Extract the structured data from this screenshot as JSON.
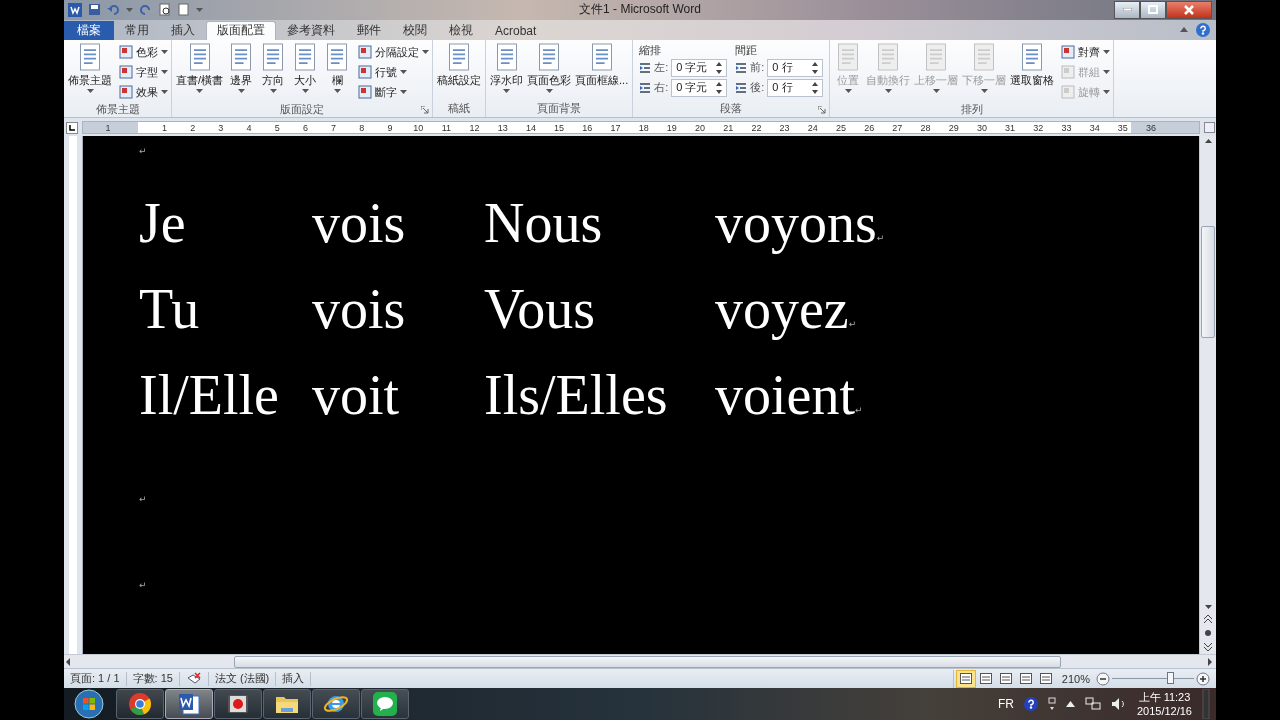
{
  "window": {
    "title": "文件1 - Microsoft Word"
  },
  "tabs": [
    {
      "label": "檔案",
      "kind": "file",
      "selected": false
    },
    {
      "label": "常用",
      "kind": "tab",
      "selected": false
    },
    {
      "label": "插入",
      "kind": "tab",
      "selected": false
    },
    {
      "label": "版面配置",
      "kind": "tab",
      "selected": true
    },
    {
      "label": "參考資料",
      "kind": "tab",
      "selected": false
    },
    {
      "label": "郵件",
      "kind": "tab",
      "selected": false
    },
    {
      "label": "校閱",
      "kind": "tab",
      "selected": false
    },
    {
      "label": "檢視",
      "kind": "tab",
      "selected": false
    },
    {
      "label": "Acrobat",
      "kind": "tab",
      "selected": false
    }
  ],
  "ribbon": {
    "groups": [
      {
        "label": "佈景主題",
        "launcher": false,
        "items": [
          {
            "kind": "large",
            "label": "佈景主題",
            "dropdown": true,
            "disabled": false
          },
          {
            "kind": "stack",
            "items": [
              {
                "label": "色彩",
                "dropdown": true,
                "disabled": false
              },
              {
                "label": "字型",
                "dropdown": true,
                "disabled": false
              },
              {
                "label": "效果",
                "dropdown": true,
                "disabled": false
              }
            ]
          }
        ]
      },
      {
        "label": "版面設定",
        "launcher": true,
        "items": [
          {
            "kind": "large",
            "label": "直書/橫書",
            "dropdown": true,
            "disabled": false
          },
          {
            "kind": "large",
            "label": "邊界",
            "dropdown": true,
            "disabled": false
          },
          {
            "kind": "large",
            "label": "方向",
            "dropdown": true,
            "disabled": false
          },
          {
            "kind": "large",
            "label": "大小",
            "dropdown": true,
            "disabled": false
          },
          {
            "kind": "large",
            "label": "欄",
            "dropdown": true,
            "disabled": false
          },
          {
            "kind": "stack",
            "items": [
              {
                "label": "分隔設定",
                "dropdown": true,
                "disabled": false
              },
              {
                "label": "行號",
                "dropdown": true,
                "disabled": false
              },
              {
                "label": "斷字",
                "dropdown": true,
                "disabled": false
              }
            ]
          }
        ]
      },
      {
        "label": "稿紙",
        "launcher": false,
        "items": [
          {
            "kind": "large",
            "label": "稿紙設定",
            "dropdown": false,
            "disabled": false
          }
        ]
      },
      {
        "label": "頁面背景",
        "launcher": false,
        "items": [
          {
            "kind": "large",
            "label": "浮水印",
            "dropdown": true,
            "disabled": false
          },
          {
            "kind": "large",
            "label": "頁面色彩",
            "dropdown": true,
            "disabled": false
          },
          {
            "kind": "large",
            "label": "頁面框線...",
            "dropdown": false,
            "disabled": false
          }
        ]
      },
      {
        "label": "段落",
        "launcher": true,
        "items": [
          {
            "kind": "spins",
            "heading": "縮排",
            "fields": [
              {
                "label": "左:",
                "value": "0 字元"
              },
              {
                "label": "右:",
                "value": "0 字元"
              }
            ]
          },
          {
            "kind": "spins",
            "heading": "間距",
            "fields": [
              {
                "label": "前:",
                "value": "0 行"
              },
              {
                "label": "後:",
                "value": "0 行"
              }
            ]
          }
        ]
      },
      {
        "label": "排列",
        "launcher": false,
        "items": [
          {
            "kind": "large",
            "label": "位置",
            "dropdown": true,
            "disabled": true
          },
          {
            "kind": "large",
            "label": "自動換行",
            "dropdown": true,
            "disabled": true
          },
          {
            "kind": "large",
            "label": "上移一層",
            "dropdown": true,
            "disabled": true
          },
          {
            "kind": "large",
            "label": "下移一層",
            "dropdown": true,
            "disabled": true
          },
          {
            "kind": "large",
            "label": "選取窗格",
            "dropdown": false,
            "disabled": false
          },
          {
            "kind": "stack",
            "items": [
              {
                "label": "對齊",
                "dropdown": true,
                "disabled": false
              },
              {
                "label": "群組",
                "dropdown": true,
                "disabled": true
              },
              {
                "label": "旋轉",
                "dropdown": true,
                "disabled": true
              }
            ]
          }
        ]
      }
    ]
  },
  "ruler": {
    "numbers": [
      "1",
      "1",
      "2",
      "3",
      "4",
      "5",
      "6",
      "7",
      "8",
      "9",
      "10",
      "11",
      "12",
      "13",
      "14",
      "15",
      "16",
      "17",
      "18",
      "19",
      "20",
      "21",
      "22",
      "23",
      "24",
      "25",
      "26",
      "27",
      "28",
      "29",
      "30",
      "31",
      "32",
      "33",
      "34",
      "35",
      "36"
    ]
  },
  "document": {
    "paragraphs": [
      {
        "kind": "empty",
        "mark": "↵"
      },
      {
        "kind": "row",
        "cells": [
          "Je",
          "vois",
          "Nous",
          "voyons"
        ],
        "mark": "↵"
      },
      {
        "kind": "row",
        "cells": [
          "Tu",
          "vois",
          "Vous",
          "voyez"
        ],
        "mark": "↵"
      },
      {
        "kind": "row",
        "cells": [
          "Il/Elle",
          "voit",
          "Ils/Elles",
          "voient"
        ],
        "mark": "↵"
      },
      {
        "kind": "empty",
        "mark": "↵"
      },
      {
        "kind": "empty",
        "mark": "↵"
      }
    ]
  },
  "status_bar": {
    "items": [
      {
        "kind": "text",
        "text": "頁面: 1 / 1"
      },
      {
        "kind": "text",
        "text": "字數: 15"
      },
      {
        "kind": "icon"
      },
      {
        "kind": "text",
        "text": "法文 (法國)"
      },
      {
        "kind": "text",
        "text": "插入"
      }
    ],
    "views": [
      {
        "selected": true
      },
      {
        "selected": false
      },
      {
        "selected": false
      },
      {
        "selected": false
      },
      {
        "selected": false
      }
    ],
    "zoom": "210%",
    "zoom_slider": {
      "level": 0.72
    }
  },
  "taskbar": {
    "apps": [
      {
        "kind": "browser",
        "selected": false
      },
      {
        "kind": "word",
        "selected": true
      },
      {
        "kind": "recorder",
        "selected": false
      },
      {
        "kind": "folder",
        "selected": false
      },
      {
        "kind": "ebrowser",
        "selected": false
      },
      {
        "kind": "chat",
        "selected": false
      }
    ],
    "language": "FR",
    "time": "上午 11:23",
    "date": "2015/12/16"
  }
}
